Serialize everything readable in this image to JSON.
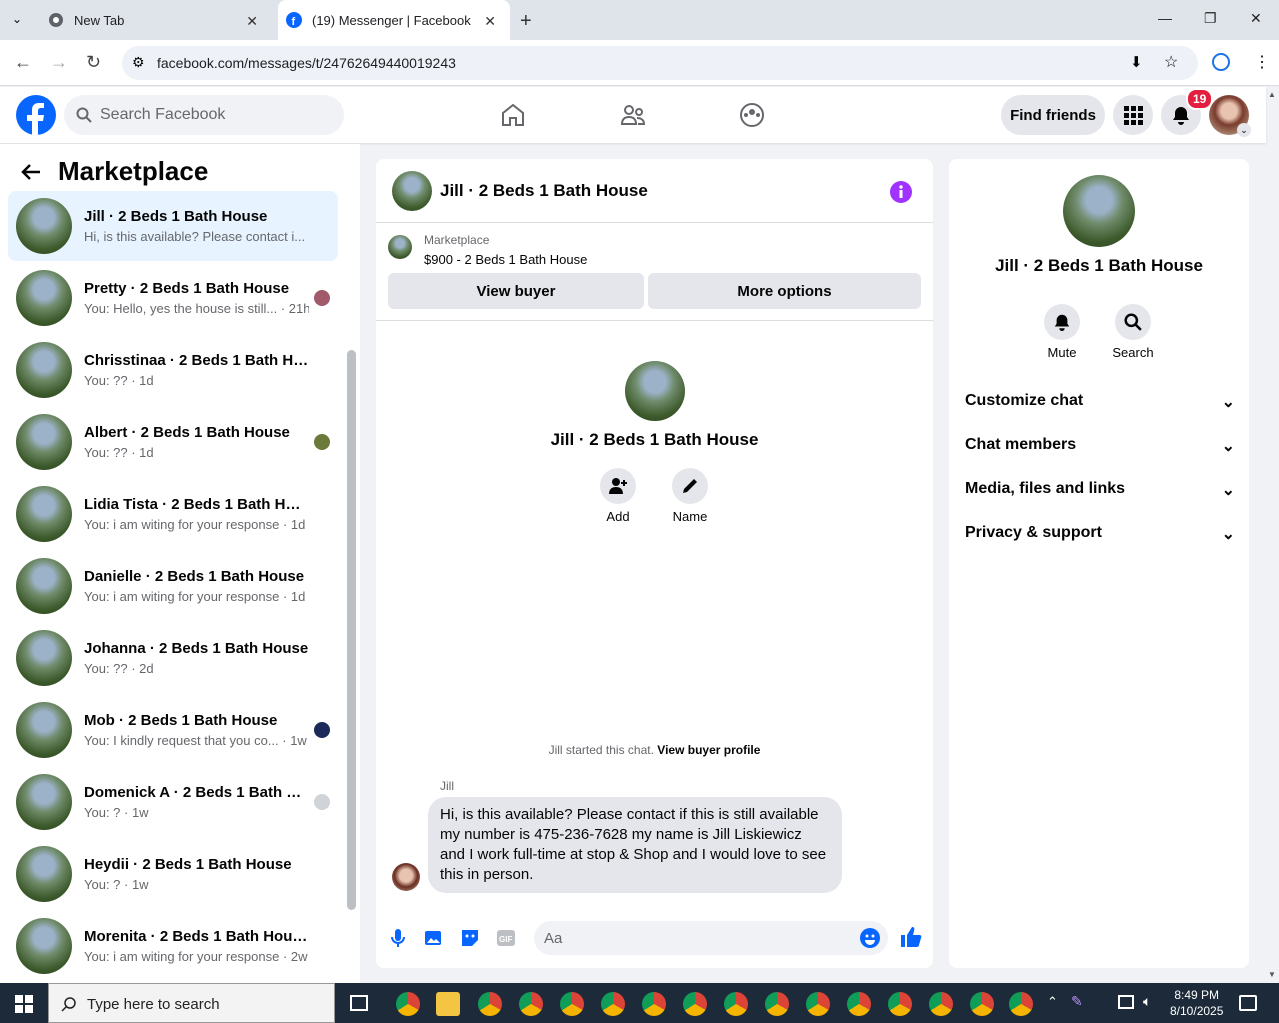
{
  "browser": {
    "tabs": [
      {
        "label": "New Tab"
      },
      {
        "label": "(19) Messenger | Facebook"
      }
    ],
    "url": "facebook.com/messages/t/24762649440019243"
  },
  "fb": {
    "search_placeholder": "Search Facebook",
    "find_friends": "Find friends",
    "notification_count": "19"
  },
  "left": {
    "title": "Marketplace",
    "conversations": [
      {
        "name": "Jill · 2 Beds 1 Bath House",
        "preview": "Hi, is this available? Please contact i... 3h"
      },
      {
        "name": "Pretty · 2 Beds 1 Bath House",
        "preview": "You: Hello, yes the house is still... · 21h"
      },
      {
        "name": "Chrisstinaa · 2 Beds 1 Bath House",
        "preview": "You: ?? · 1d"
      },
      {
        "name": "Albert · 2 Beds 1 Bath House",
        "preview": "You: ?? · 1d"
      },
      {
        "name": "Lidia Tista · 2 Beds 1 Bath House",
        "preview": "You: i am witing for your response · 1d"
      },
      {
        "name": "Danielle · 2 Beds 1 Bath House",
        "preview": "You: i am witing for your response · 1d"
      },
      {
        "name": "Johanna · 2 Beds 1 Bath House",
        "preview": "You: ?? · 2d"
      },
      {
        "name": "Mob · 2 Beds 1 Bath House",
        "preview": "You: I kindly request that you co... · 1w"
      },
      {
        "name": "Domenick A · 2 Beds 1 Bath H...",
        "preview": "You: ? · 1w"
      },
      {
        "name": "Heydii · 2 Beds 1 Bath House",
        "preview": "You: ? · 1w"
      },
      {
        "name": "Morenita · 2 Beds 1 Bath House",
        "preview": "You: i am witing for your response · 2w"
      }
    ]
  },
  "chat": {
    "title": "Jill · 2 Beds 1 Bath House",
    "marketplace_label": "Marketplace",
    "listing": "$900 - 2 Beds 1 Bath House",
    "view_buyer": "View buyer",
    "more_options": "More options",
    "profile_name": "Jill · 2 Beds 1 Bath House",
    "add_label": "Add",
    "name_label": "Name",
    "started_text": "Jill started this chat.",
    "view_profile": "View buyer profile",
    "sender": "Jill",
    "message": "Hi, is this available? Please contact if this is still available my number is 475-236-7628 my name is Jill Liskiewicz and I work full-time at stop & Shop and I would love to see this in person.",
    "composer_placeholder": "Aa"
  },
  "details": {
    "name": "Jill · 2 Beds 1 Bath House",
    "mute": "Mute",
    "search": "Search",
    "sections": [
      "Customize chat",
      "Chat members",
      "Media, files and links",
      "Privacy & support"
    ]
  },
  "taskbar": {
    "search_placeholder": "Type here to search",
    "time": "8:49 PM",
    "date": "8/10/2025"
  },
  "colors": {
    "fb_blue": "#0866ff",
    "accent_purple": "#a033ff",
    "badge_red": "#e41e3f"
  }
}
